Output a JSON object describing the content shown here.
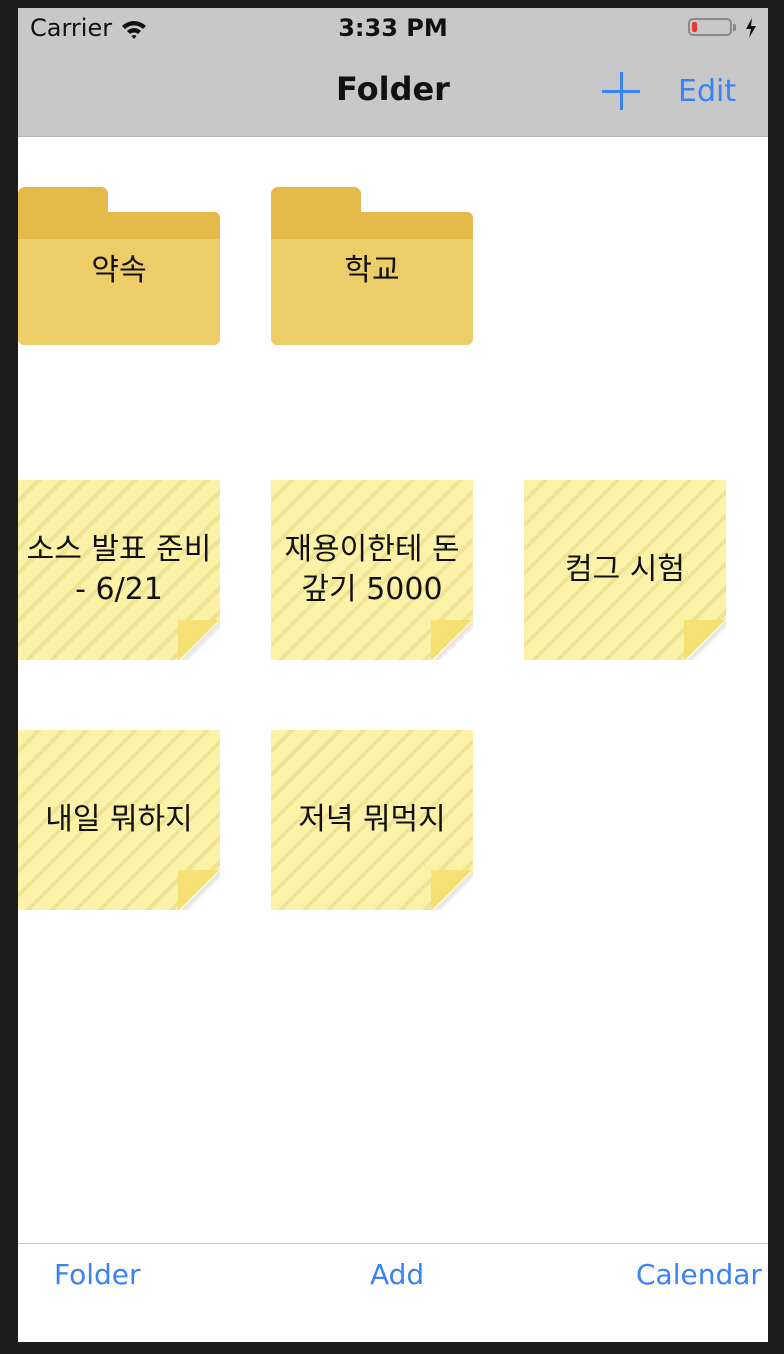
{
  "status_bar": {
    "carrier": "Carrier",
    "time": "3:33 PM",
    "battery_level": 0.15
  },
  "nav_bar": {
    "title": "Folder",
    "add_icon": "plus-icon",
    "edit_label": "Edit"
  },
  "folders": [
    {
      "name": "약속"
    },
    {
      "name": "학교"
    }
  ],
  "notes": [
    {
      "text": "소스 발표 준비\n- 6/21"
    },
    {
      "text": "재용이한테 돈\n갚기 5000"
    },
    {
      "text": "컴그 시험"
    },
    {
      "text": "내일 뭐하지"
    },
    {
      "text": "저녁 뭐먹지"
    }
  ],
  "tab_bar": {
    "items": [
      {
        "label": "Folder"
      },
      {
        "label": "Add"
      },
      {
        "label": "Calendar"
      }
    ]
  },
  "colors": {
    "accent": "#3a82f7",
    "folder": "#eccd68",
    "note": "#fcf2a7",
    "bar_background": "#c8c8c8"
  }
}
